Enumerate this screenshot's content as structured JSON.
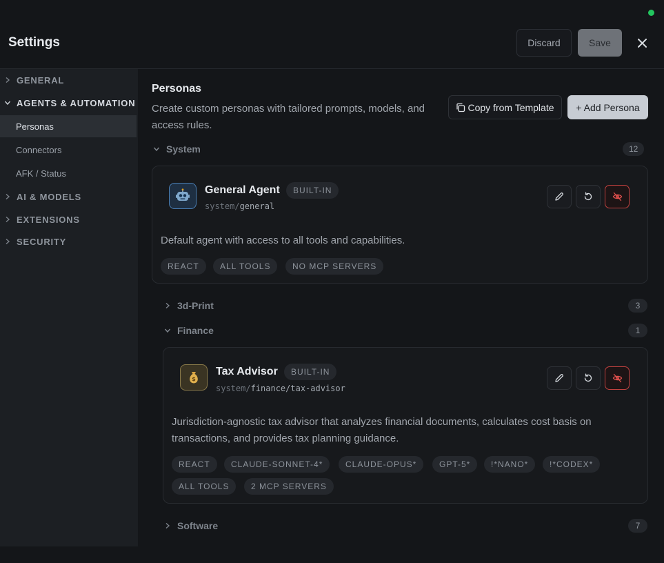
{
  "header": {
    "title": "Settings",
    "discard_label": "Discard",
    "save_label": "Save"
  },
  "sidebar": {
    "sections": [
      {
        "label": "GENERAL",
        "expanded": false
      },
      {
        "label": "AGENTS & AUTOMATION",
        "expanded": true
      },
      {
        "label": "AI & MODELS",
        "expanded": false
      },
      {
        "label": "EXTENSIONS",
        "expanded": false
      },
      {
        "label": "SECURITY",
        "expanded": false
      }
    ],
    "items": [
      {
        "label": "Personas",
        "active": true
      },
      {
        "label": "Connectors",
        "active": false
      },
      {
        "label": "AFK / Status",
        "active": false
      }
    ]
  },
  "main": {
    "title": "Personas",
    "description": "Create custom personas with tailored prompts, models, and access rules.",
    "copy_template_label": "Copy from Template",
    "add_persona_label": "+ Add Persona",
    "groups": [
      {
        "name": "System",
        "count": "12",
        "expanded": true
      },
      {
        "name": "3d-Print",
        "count": "3",
        "expanded": false
      },
      {
        "name": "Finance",
        "count": "1",
        "expanded": true
      },
      {
        "name": "Software",
        "count": "7",
        "expanded": false
      }
    ],
    "personas": [
      {
        "name": "General Agent",
        "badge": "BUILT-IN",
        "path_prefix": "system/",
        "path_name": "general",
        "avatar": "robot-icon",
        "description": "Default agent with access to all tools and capabilities.",
        "tags": [
          "REACT",
          "ALL TOOLS",
          "NO MCP SERVERS"
        ]
      },
      {
        "name": "Tax Advisor",
        "badge": "BUILT-IN",
        "path_prefix": "system/",
        "path_name": "finance/tax-advisor",
        "avatar": "money-bag-icon",
        "description": "Jurisdiction-agnostic tax advisor that analyzes financial documents, calculates cost basis on transactions, and provides tax planning guidance.",
        "tags": [
          "REACT",
          "CLAUDE-SONNET-4*",
          "CLAUDE-OPUS*",
          "GPT-5*",
          "!*NANO*",
          "!*CODEX*",
          "ALL TOOLS",
          "2 MCP SERVERS"
        ]
      }
    ]
  },
  "colors": {
    "background": "#141619",
    "sidebar": "#1c1f23",
    "status_dot": "#22c55e",
    "danger": "#c2413f",
    "primary_button": "#c7ccd3"
  }
}
